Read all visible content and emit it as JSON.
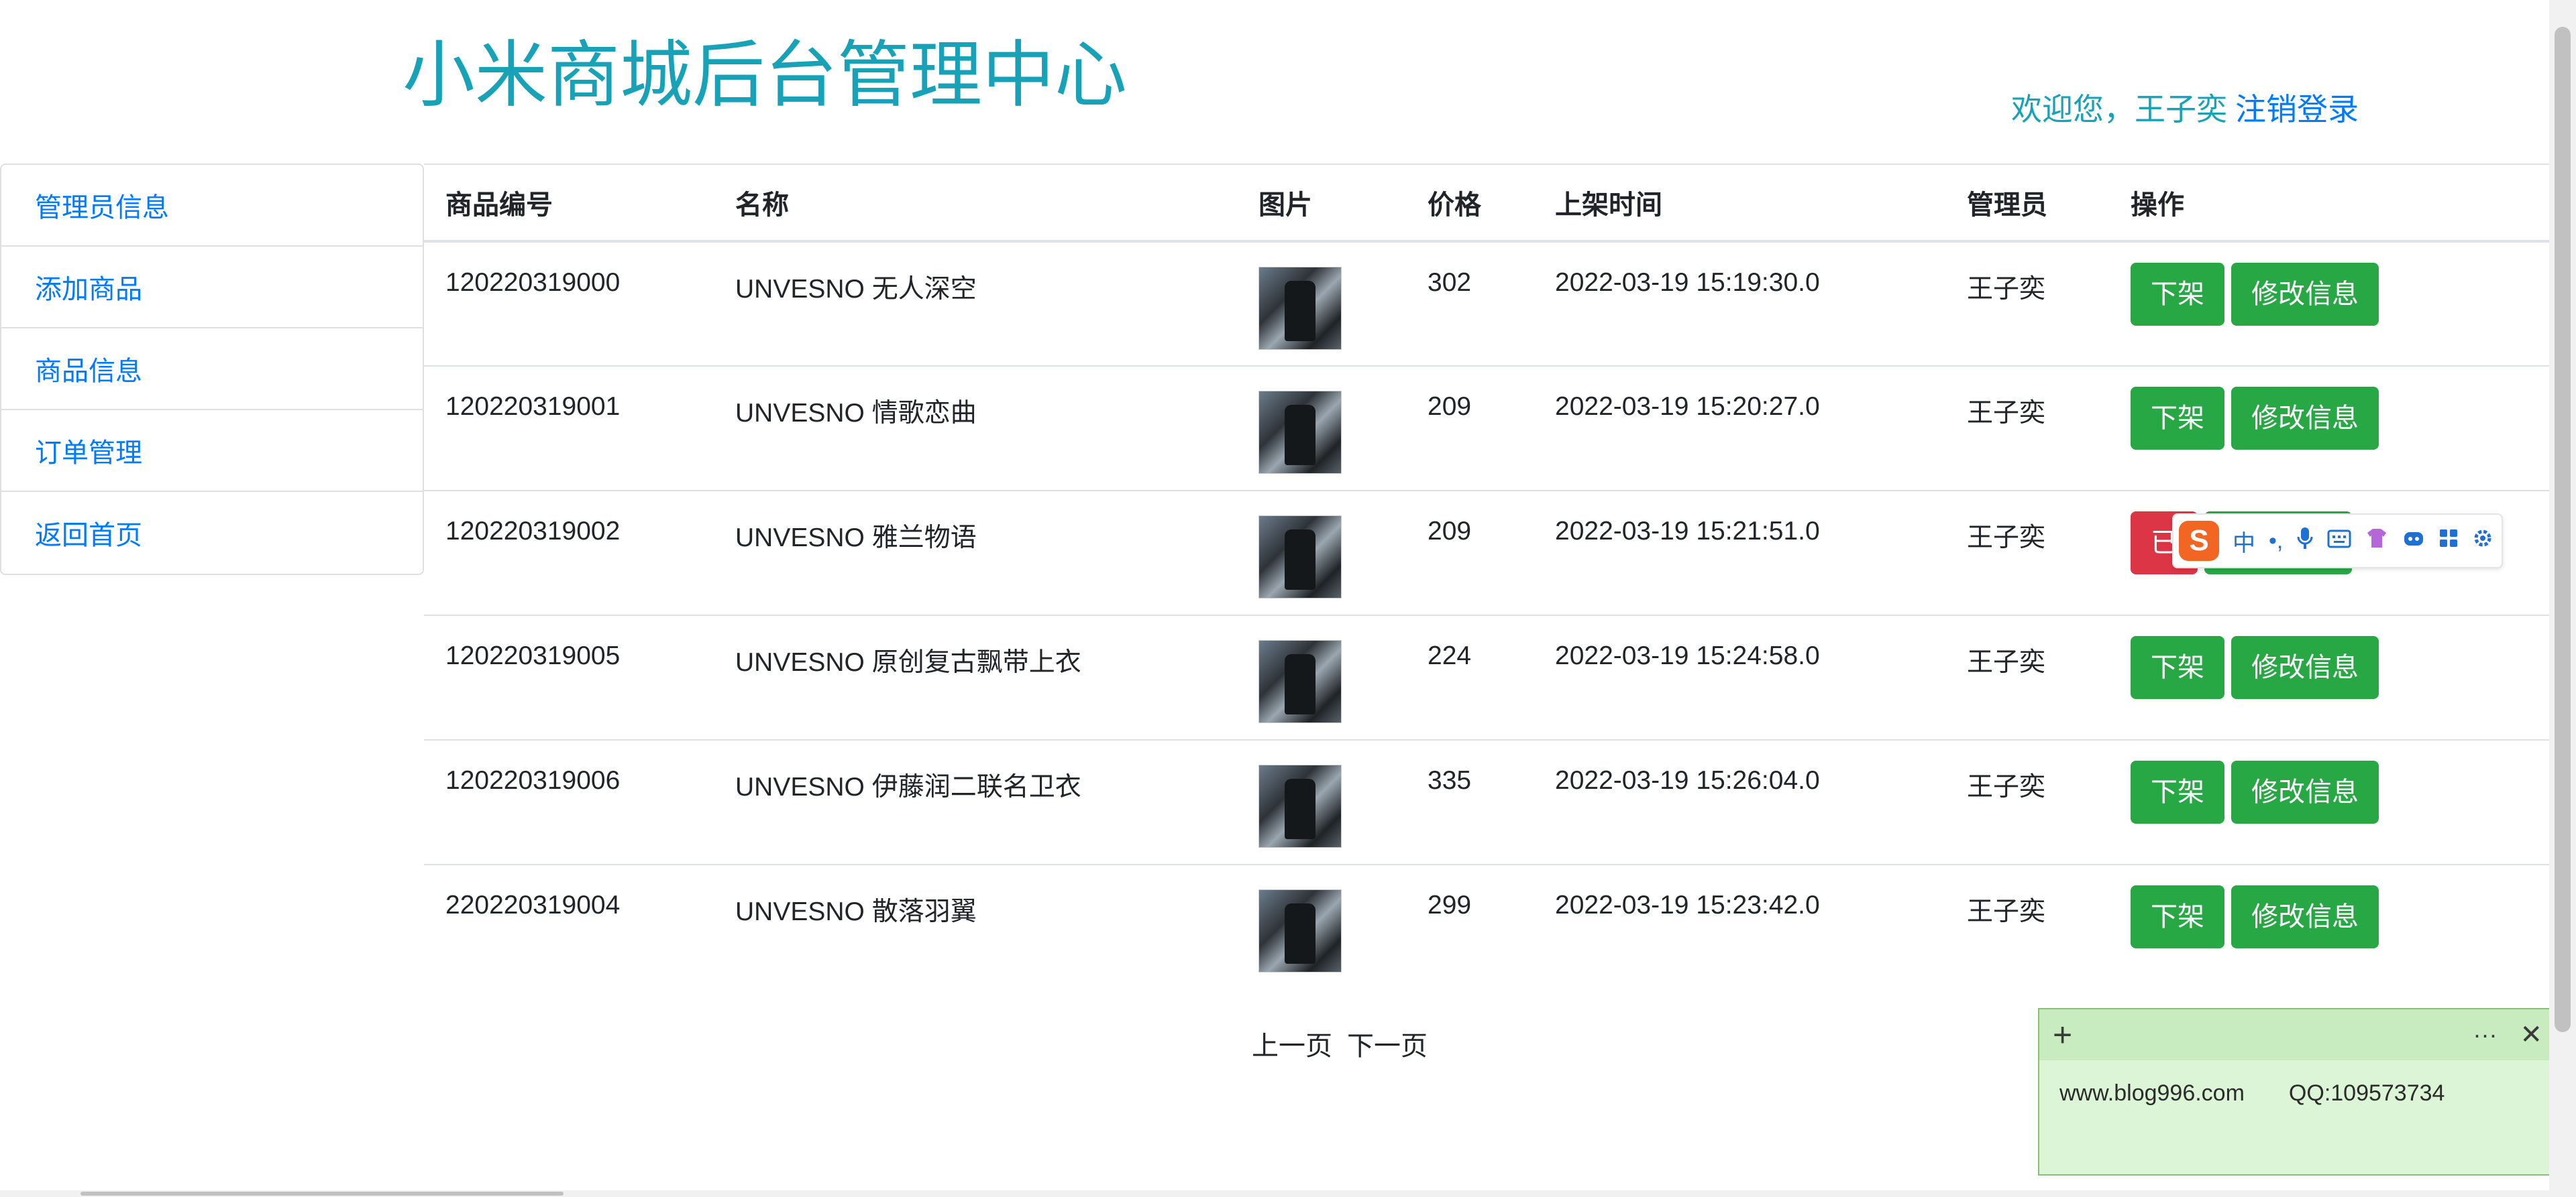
{
  "header": {
    "title": "小米商城后台管理中心",
    "welcome": "欢迎您，王子奕",
    "logout": "注销登录"
  },
  "sidebar": {
    "items": [
      {
        "label": "管理员信息"
      },
      {
        "label": "添加商品"
      },
      {
        "label": "商品信息"
      },
      {
        "label": "订单管理"
      },
      {
        "label": "返回首页"
      }
    ]
  },
  "table": {
    "headers": [
      "商品编号",
      "名称",
      "图片",
      "价格",
      "上架时间",
      "管理员",
      "操作"
    ],
    "rows": [
      {
        "id": "120220319000",
        "name": "UNVESNO 无人深空",
        "price": "302",
        "time": "2022-03-19 15:19:30.0",
        "admin": "王子奕"
      },
      {
        "id": "120220319001",
        "name": "UNVESNO 情歌恋曲",
        "price": "209",
        "time": "2022-03-19 15:20:27.0",
        "admin": "王子奕"
      },
      {
        "id": "120220319002",
        "name": "UNVESNO 雅兰物语",
        "price": "209",
        "time": "2022-03-19 15:21:51.0",
        "admin": "王子奕"
      },
      {
        "id": "120220319005",
        "name": "UNVESNO 原创复古飘带上衣",
        "price": "224",
        "time": "2022-03-19 15:24:58.0",
        "admin": "王子奕"
      },
      {
        "id": "120220319006",
        "name": "UNVESNO 伊藤润二联名卫衣",
        "price": "335",
        "time": "2022-03-19 15:26:04.0",
        "admin": "王子奕"
      },
      {
        "id": "220220319004",
        "name": "UNVESNO 散落羽翼",
        "price": "299",
        "time": "2022-03-19 15:23:42.0",
        "admin": "王子奕"
      }
    ],
    "actions": {
      "takedown": "下架",
      "edit": "修改信息",
      "taken_down": "已"
    }
  },
  "pager": {
    "prev": "上一页",
    "next": "下一页"
  },
  "ime": {
    "logo": "S",
    "mode": "中",
    "punct": "•,"
  },
  "note": {
    "add": "+",
    "more": "···",
    "close": "✕",
    "website": "www.blog996.com",
    "qq": "QQ:109573734"
  },
  "colors": {
    "title": "#17a2b8",
    "link": "#007bff",
    "success": "#28a745",
    "danger": "#dc3545",
    "note_bg": "#dcf5d6"
  }
}
